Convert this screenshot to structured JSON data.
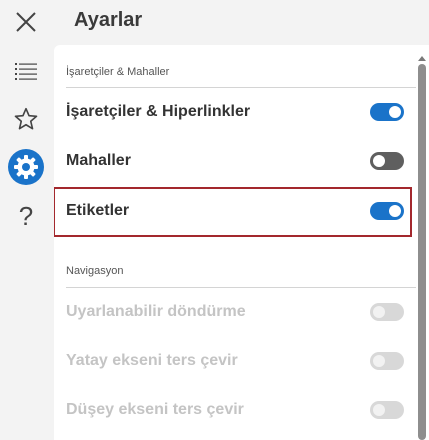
{
  "header": {
    "title": "Ayarlar"
  },
  "rail": {
    "items": [
      {
        "name": "close-icon"
      },
      {
        "name": "list-icon"
      },
      {
        "name": "star-icon"
      },
      {
        "name": "gear-icon"
      },
      {
        "name": "help-icon"
      }
    ],
    "accent": "#1a73c9"
  },
  "sections": [
    {
      "label": "İşaretçiler & Mahaller",
      "items": [
        {
          "label": "İşaretçiler & Hiperlinkler",
          "state": "on"
        },
        {
          "label": "Mahaller",
          "state": "off"
        },
        {
          "label": "Etiketler",
          "state": "on",
          "highlighted": true
        }
      ]
    },
    {
      "label": "Navigasyon",
      "items": [
        {
          "label": "Uyarlanabilir döndürme",
          "state": "disabled"
        },
        {
          "label": "Yatay ekseni ters çevir",
          "state": "disabled"
        },
        {
          "label": "Düşey ekseni ters çevir",
          "state": "disabled"
        }
      ]
    }
  ],
  "colors": {
    "toggle_on": "#1a73c9",
    "toggle_off": "#5f5f5f",
    "highlight": "#a3282d"
  }
}
